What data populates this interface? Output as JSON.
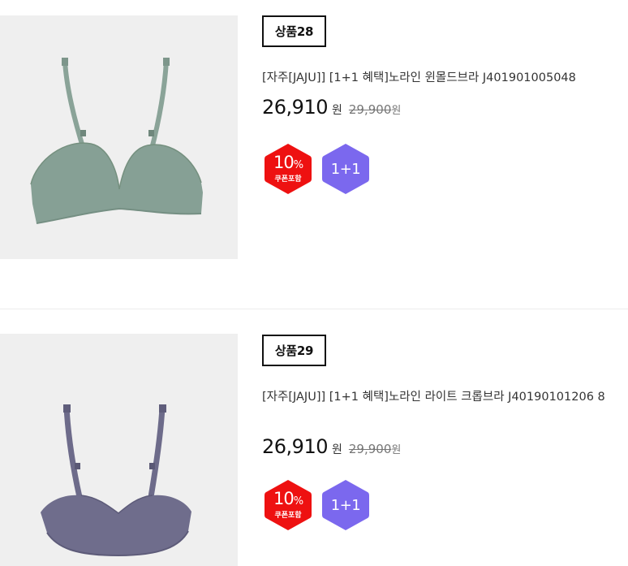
{
  "colors": {
    "discount_badge": "#ee1111",
    "bogo_badge": "#7b68ee",
    "thumb_bg": "#efefef",
    "bra_sage": "#86a095",
    "bra_purple": "#6f6d8c"
  },
  "products": [
    {
      "rank": "상품28",
      "title": "[자주[JAJU]] [1+1 혜택]노라인 윈몰드브라 J401901005048",
      "price": "26,910",
      "price_unit": "원",
      "original_price": "29,900",
      "original_unit": "원",
      "discount_percent": "10",
      "discount_symbol": "%",
      "discount_label": "쿠폰포함",
      "promo_label": "1+1",
      "image_icon": "sage-green-bra-image"
    },
    {
      "rank": "상품29",
      "title": "[자주[JAJU]] [1+1 혜택]노라인 라이트 크롭브라 J40190101206 8",
      "price": "26,910",
      "price_unit": "원",
      "original_price": "29,900",
      "original_unit": "원",
      "discount_percent": "10",
      "discount_symbol": "%",
      "discount_label": "쿠폰포함",
      "promo_label": "1+1",
      "image_icon": "purple-crop-bra-image"
    }
  ]
}
